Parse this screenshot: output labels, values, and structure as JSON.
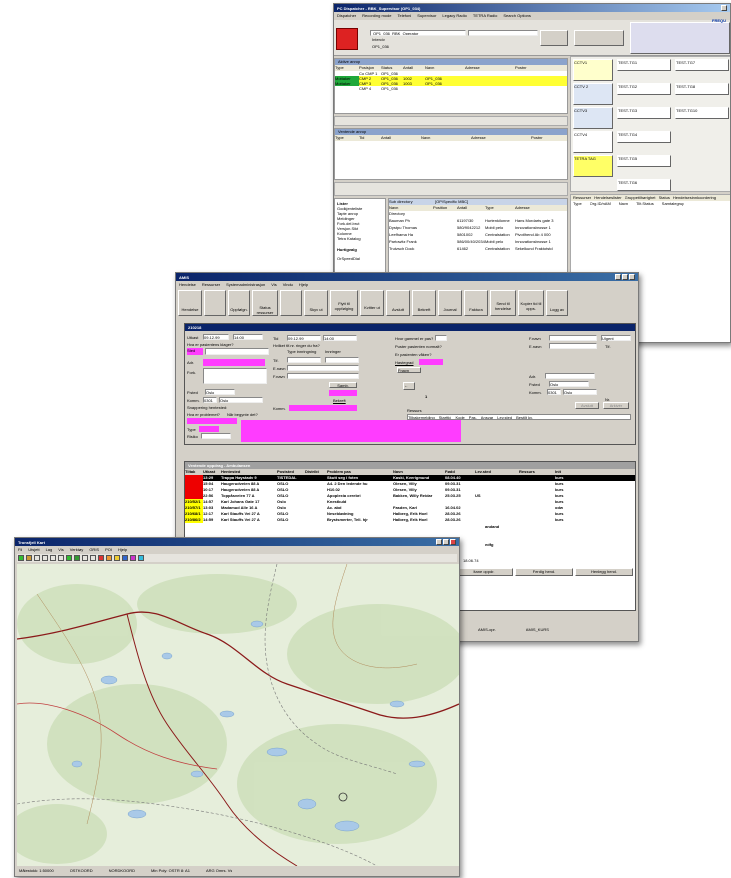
{
  "w1": {
    "title": "PC Dispatcher - RBK_Supervisor (OP1_034)",
    "menu": [
      "Dispatcher",
      "Recording mode",
      "Telefoni",
      "Supervisor",
      "Legacy Radio",
      "TETRA Radio",
      "Search Options"
    ],
    "user": "OP1_036_RBK_Operator",
    "field2": "Interciv",
    "field3": "OP1_036",
    "panel1": "Aktive anrop",
    "cols1": [
      "Type",
      "Posisjon",
      "Status",
      "Antall",
      "Navn",
      "Adresse",
      "Postnr"
    ],
    "rows1": [
      [
        "",
        "Co CMP 1",
        "OP1_036",
        "",
        "",
        "",
        ""
      ],
      [
        "Mottaker",
        "CMP 2",
        "OP1_036",
        "1002",
        "OP1_036",
        "",
        ""
      ],
      [
        "Mottaker",
        "CMP 3",
        "OP1_036",
        "1003",
        "OP1_036",
        "",
        ""
      ],
      [
        "",
        "CMP 4",
        "OP1_036",
        "",
        "",
        "",
        ""
      ]
    ],
    "panel2": "Ventende anrop",
    "cols2": [
      "Type",
      "Tid",
      "Antall",
      "Navn",
      "Adresse",
      "Postnr"
    ],
    "list_header": "Sub directory",
    "list_path": "[OP/Specific MBC]",
    "lhs": [
      "Lister",
      "Godkjenteliste",
      "Tapte anrop",
      "Meldinger",
      "Fork.del.brut",
      "Versjon.Sikt",
      "Kolonne",
      "Tetra Katalog",
      "Hurtigvalg",
      "OrSpeedDial"
    ],
    "lcols": [
      "Navn",
      "Position",
      "Antall",
      "Type",
      "Adresse"
    ],
    "lrows": [
      [
        "Directory",
        "",
        "",
        "",
        ""
      ],
      [
        "Bauman Ph",
        "",
        "61197/30",
        "Hurtenkilonne",
        "Hans Mordarts gate 3"
      ],
      [
        "Dystpu Thomas",
        "",
        "580/9042212",
        "Mobil pelo",
        "Innovationsbrosse 1"
      ],
      [
        "Leefhama Ha",
        "",
        "5801002",
        "Centralstation",
        "Pivotlhend Ab 4 000"
      ],
      [
        "Partowitz Frank",
        "",
        "586/00/40/2034",
        "Mobil pelo",
        "Innovationsbrosse 1"
      ],
      [
        "Trutzsch Dock",
        "",
        "61462",
        "Centralstation",
        "Sekelkund Fraktotstd"
      ]
    ],
    "tiles": [
      "CCTV1",
      "TEST-TG1",
      "TEST-TG7",
      "CCTV 2",
      "TEST-TG2",
      "TEST-TG8",
      "CCTV3",
      "TEST-TG3",
      "TEST-TG10",
      "CCTV4",
      "TEST-TG4",
      "TETRA TAG",
      "TEST-TG5",
      "TEST-TG6"
    ],
    "rtabs": [
      "Ressurser",
      "Hendelseslister",
      "Gruppetilhørighet",
      "Status",
      "Hendelsesinnkoordering"
    ],
    "rcols": [
      "Type",
      "Org.ID/nAM",
      "Navn",
      "Tilt.Status",
      "Samtalegrup"
    ],
    "freq": "FREQU",
    "ctt": "CTT"
  },
  "w2": {
    "title": "AMIS",
    "menu": [
      "Hendelse",
      "Ressurser",
      "Systemadministrasjon",
      "Vis",
      "Vindu",
      "Hjelp"
    ],
    "toolbar": [
      "Hendelse",
      "",
      "Oppfølgn.",
      "Status ressurser",
      "",
      "Skyv ut",
      "Flytt til oppfølging",
      "Kvitter ut",
      "Avslutt",
      "Bekreft",
      "Oppfølgn.",
      "Journal",
      "Faktura",
      "Send til hendelse",
      "Kopier tid til opps.",
      "Logg av"
    ],
    "inner_title": "210218",
    "f_utkast": "Utkast",
    "d1": "09.12.99",
    "t1": "14:00",
    "hva": "Hva er pasientens klager?",
    "sted": "Sted",
    "adr": "Adr.",
    "fork": "Fork.",
    "pted": "P.sted",
    "kom": "Komm.",
    "kom_no": "0301",
    "city": "Oslo",
    "snapping": "Snappering hentested:",
    "hva_er": "Hva er problemet?",
    "nar": "Når begynte det?",
    "type": "Type",
    "risiko": "Risiko",
    "tid": "Tid",
    "d2": "09.12.99",
    "t2": "14:00",
    "hvilket": "Hvilket tlf.nr. ringer du fra?",
    "tlf": "Tlf.",
    "enavn": "E.navn",
    "fnavn": "F.navn",
    "innringer": "Innringer",
    "type_innr": "Type innringning",
    "samtbtn": "Samb.",
    "bekreft": "Bekreft",
    "komm": "Komm.",
    "q1": "Hvor gammel er pas?",
    "q2": "Puster pasienten normalt?",
    "q3": "Er pasienten våken?",
    "hastegrad": "Hastegrad",
    "fntj": "Fnavn",
    "fnavn2": "F.navn",
    "enavn2": "E.navn",
    "tlf2": "Tlf.",
    "adr2": "Adr.",
    "pted2": "P.sted",
    "komm2": "Komm.",
    "nr": "Nr.",
    "urgent": "Ulgent",
    "ressurs": "Ressurs",
    "rcols": [
      "Tilbakemelding",
      "Starttid",
      "Kode",
      "Pas.",
      "Ansvar",
      "Nr",
      "Lev.sted",
      "Bestilt kv."
    ],
    "avslutt": "Avslutt",
    "arkiver": "Arkivér",
    "lower_title": "Ventende oppdrag - Ambulansen",
    "lcols": [
      "Tiltak",
      "Utkast",
      "Hentested",
      "Poststed",
      "Distrikt",
      "Problem pas",
      "Navn",
      "Fødd",
      "Lev.sted",
      "Ressurs",
      "Init"
    ],
    "lrows": [
      [
        "",
        "13:29",
        "Trappa Høystadv 9",
        "TISTEDAL",
        "",
        "Skutt seg i foten",
        "Kaski, Kverigmund",
        "08.04.40",
        "",
        "",
        "kurs"
      ],
      [
        "",
        "15:04",
        "Haugerudveien 88 A",
        "OSLO",
        "",
        "A4. 2 Den ledende hu",
        "Olesen, Villy",
        "09.03.31",
        "",
        "",
        "kurs"
      ],
      [
        "",
        "10:17",
        "Haugerudveien 88 A",
        "OSLO",
        "",
        "H10.02",
        "Olesen, Villy",
        "09.03.31",
        "",
        "",
        "kurs"
      ],
      [
        "",
        "22:56",
        "Toppåsveien 77 A",
        "OSLO",
        "",
        "Apoplexia cerebri",
        "Bakken, Willy Reidar",
        "25.03.25",
        "US",
        "",
        "kurs"
      ],
      [
        "210/52/1",
        "14:57",
        "Karl Johans Gate 17",
        "Oslo",
        "",
        "Knestkuld",
        "",
        "",
        "",
        "",
        "kurs"
      ],
      [
        "210/57/1",
        "13:03",
        "Madamud Alle 16 A",
        "Oslo",
        "",
        "Ac. abd",
        "Fasden, Karl",
        "16.04.02",
        "",
        "",
        "odw"
      ],
      [
        "210/68/1",
        "12:17",
        "Karl Stauffs Vei 27 A",
        "OSLO",
        "",
        "Neseblødning",
        "Halberg, Erik Hoel",
        "28.03.26",
        "",
        "",
        "kurs"
      ],
      [
        "210/86/2",
        "14:59",
        "Karl Stauffs Vei 27 A",
        "OSLO",
        "",
        "Brystsmerter, Tell. hjr",
        "Halberg, Erik Hoel",
        "28.03.26",
        "",
        "",
        "kurs"
      ]
    ],
    "extra": [
      "andand",
      "",
      "edfg",
      "",
      "18.06.74"
    ],
    "status": [
      "",
      "AMIS-opr.",
      "AMIS_KURS"
    ],
    "bottom_btns": [
      "ltane oppdr.",
      "Ferdig hend.",
      "Henlegg hend."
    ]
  },
  "w3": {
    "title": "Tronsfjell Kart",
    "menu": [
      "Fil",
      "Utsjett",
      "Lag",
      "Vis",
      "Verktøy",
      "GRIS",
      "POI",
      "Hjelp"
    ],
    "map_labels": [],
    "status": [
      "Målestokk: 1:50000",
      "OSTKOORD",
      "NORDKOORD",
      "Min Poly: OSTR 8: A1",
      "ARG Omrs. Vs"
    ]
  }
}
